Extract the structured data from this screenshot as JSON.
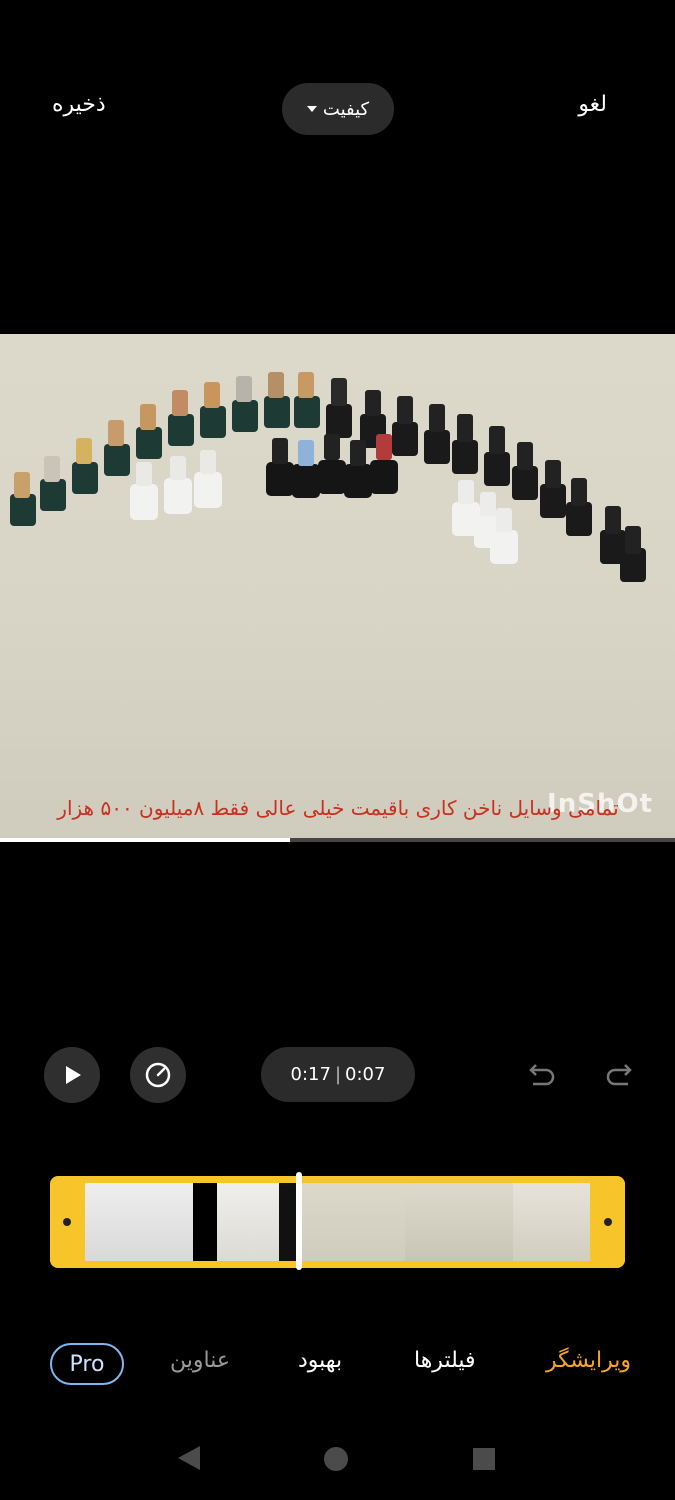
{
  "top_bar": {
    "save_label": "ذخیره",
    "quality_label": "کیفیت",
    "cancel_label": "لغو"
  },
  "preview": {
    "caption": "تمامی وسایل ناخن کاری باقیمت خیلی عالی فقط ۸میلیون ۵۰۰ هزار",
    "watermark": "InShOt",
    "progress_fraction": 0.43
  },
  "controls": {
    "current_time": "0:17",
    "total_time": "0:07"
  },
  "tabs": {
    "pro": "Pro",
    "titles": "عناوین",
    "enhance": "بهبود",
    "filters": "فیلترها",
    "editor": "ویرایشگر"
  },
  "colors": {
    "accent": "#f5a623",
    "timeline": "#f7c52a",
    "caption": "#c8301f",
    "pro_border": "#7fb7f0"
  }
}
